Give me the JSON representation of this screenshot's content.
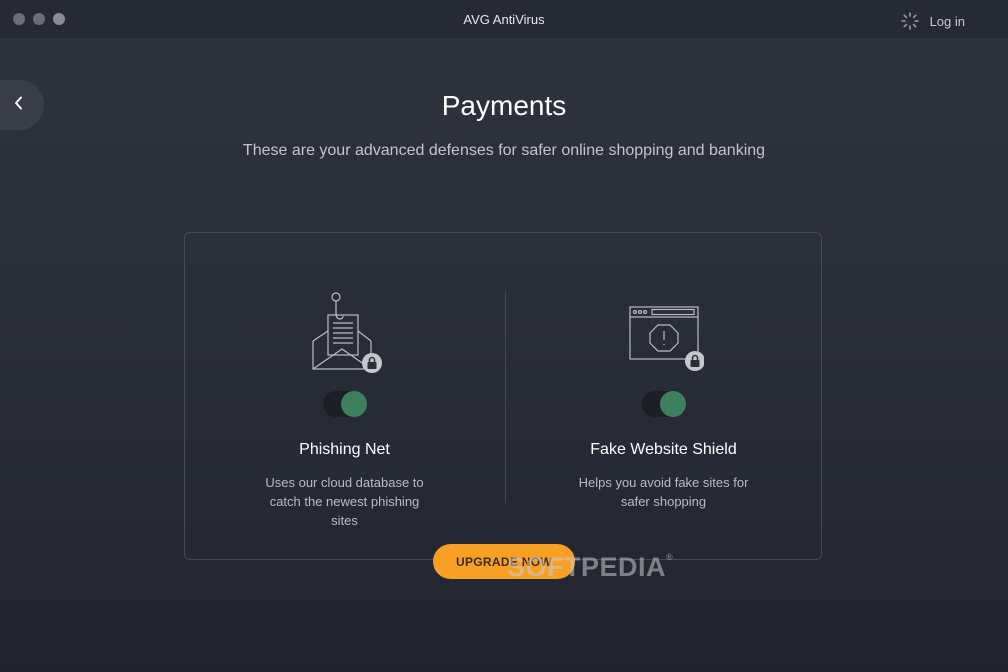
{
  "window": {
    "title": "AVG AntiVirus"
  },
  "header": {
    "login_label": "Log in",
    "login_icon": "user-loading-icon",
    "back_icon": "chevron-left-icon"
  },
  "page": {
    "title": "Payments",
    "subtitle": "These are your advanced defenses for safer online shopping and banking"
  },
  "features": [
    {
      "title": "Phishing Net",
      "description": "Uses our cloud database to catch the newest phishing sites",
      "icon": "phishing-envelope-icon",
      "toggle_on": true,
      "locked": true
    },
    {
      "title": "Fake Website Shield",
      "description": "Helps you avoid fake sites for safer shopping",
      "icon": "fake-website-icon",
      "toggle_on": true,
      "locked": true
    }
  ],
  "cta": {
    "label": "UPGRADE NOW"
  },
  "watermark": {
    "text": "SOFTPEDIA",
    "mark": "®"
  },
  "colors": {
    "accent": "#f7a024",
    "toggle_on": "#3d8060",
    "background": "#2a2e39"
  }
}
